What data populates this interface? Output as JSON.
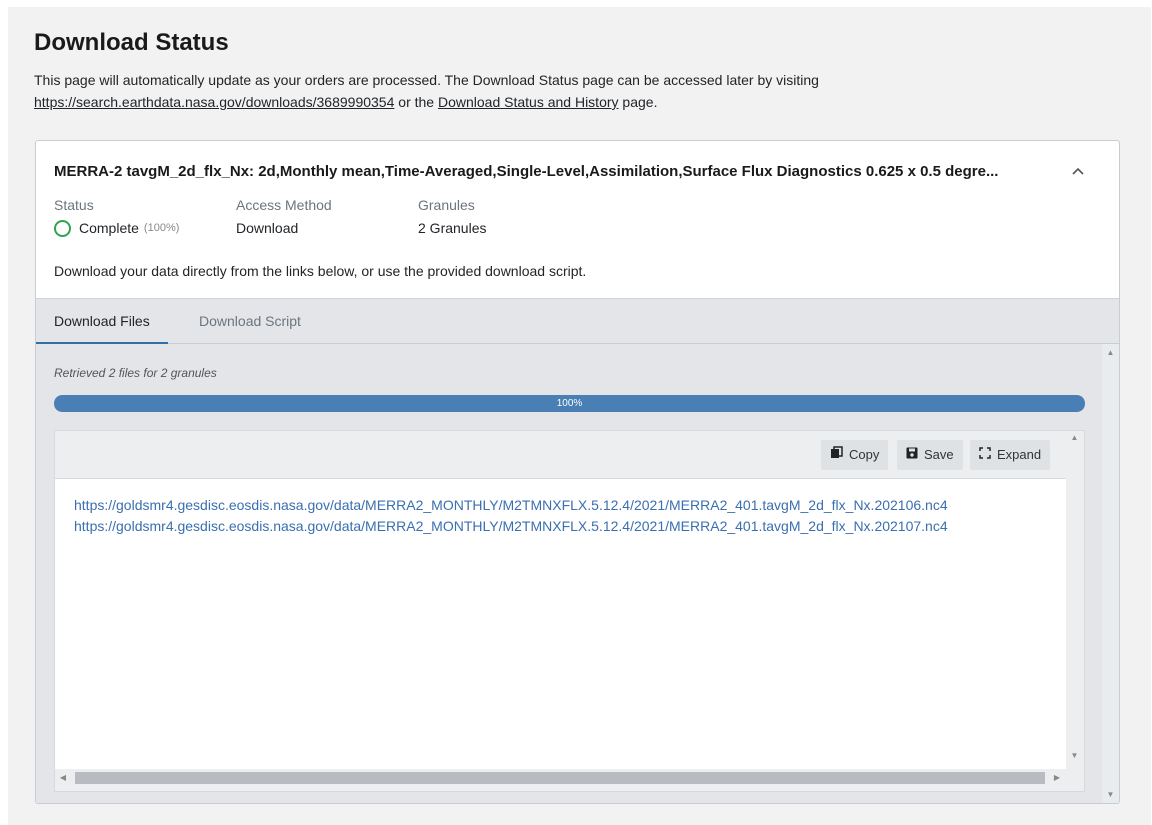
{
  "page": {
    "title": "Download Status",
    "intro_text": "This page will automatically update as your orders are processed. The Download Status page can be accessed later by visiting",
    "intro_link": "https://search.earthdata.nasa.gov/downloads/3689990354",
    "intro_or": "or the",
    "history_link": "Download Status and History",
    "intro_end": "page."
  },
  "order": {
    "dataset_name": "MERRA-2 tavgM_2d_flx_Nx: 2d,Monthly mean,Time-Averaged,Single-Level,Assimilation,Surface Flux Diagnostics 0.625 x 0.5 degre...",
    "collapse_icon": "chevron-up-icon",
    "status_label": "Status",
    "status_value": "Complete",
    "status_pct": "(100%)",
    "status_color": "#2ea44f",
    "access_label": "Access Method",
    "access_value": "Download",
    "granules_label": "Granules",
    "granules_value": "2 Granules",
    "help_text": "Download your data directly from the links below, or use the provided download script."
  },
  "tabs": [
    {
      "label": "Download Files",
      "active": true
    },
    {
      "label": "Download Script",
      "active": false
    }
  ],
  "files": {
    "retrieved_text": "Retrieved 2 files for 2 granules",
    "progress_label": "100%",
    "progress_fraction": 1.0,
    "progress_color": "#4a7fb5",
    "toolbar": {
      "copy_label": "Copy",
      "save_label": "Save",
      "expand_label": "Expand"
    },
    "links": [
      "https://goldsmr4.gesdisc.eosdis.nasa.gov/data/MERRA2_MONTHLY/M2TMNXFLX.5.12.4/2021/MERRA2_401.tavgM_2d_flx_Nx.202106.nc4",
      "https://goldsmr4.gesdisc.eosdis.nasa.gov/data/MERRA2_MONTHLY/M2TMNXFLX.5.12.4/2021/MERRA2_401.tavgM_2d_flx_Nx.202107.nc4"
    ]
  }
}
